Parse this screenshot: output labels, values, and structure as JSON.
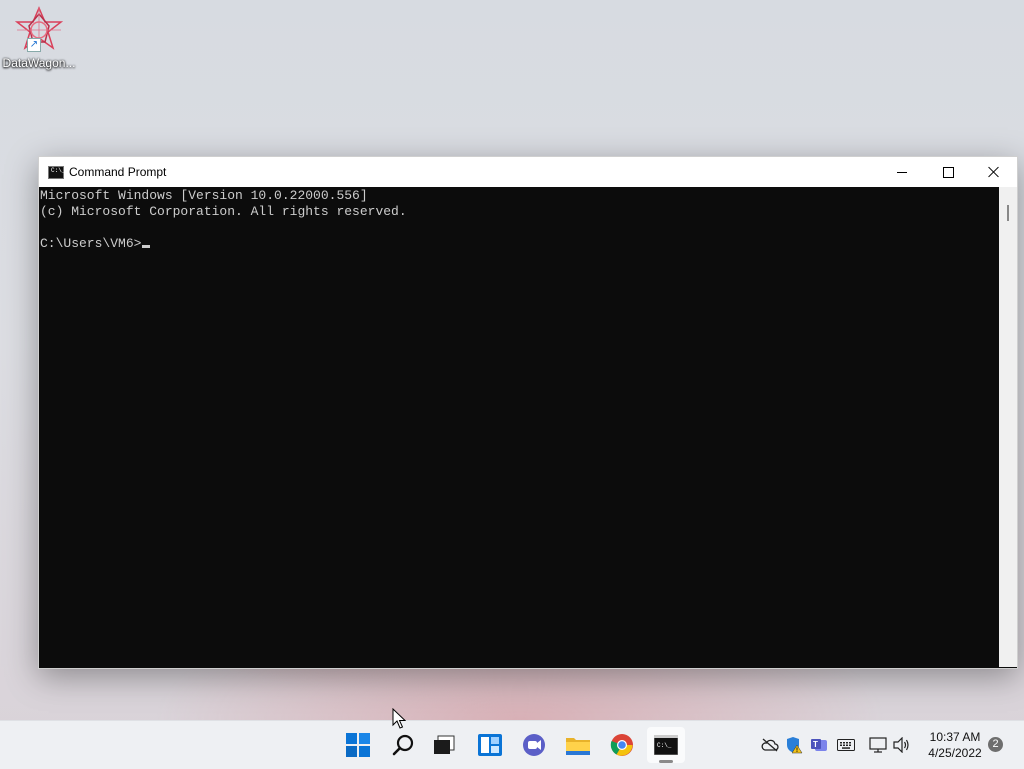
{
  "desktop": {
    "icons": [
      {
        "label": "DataWagon...",
        "icon": "datawagon-icon",
        "shortcut_icon": "shortcut-arrow-icon"
      }
    ]
  },
  "window": {
    "title": "Command Prompt",
    "icon": "terminal-app-icon",
    "icon_text": "C:\\_",
    "controls": [
      "minimize",
      "maximize",
      "close"
    ]
  },
  "console": {
    "lines": [
      "Microsoft Windows [Version 10.0.22000.556]",
      "(c) Microsoft Corporation. All rights reserved.",
      "",
      "C:\\Users\\VM6>"
    ]
  },
  "taskbar": {
    "pinned": [
      {
        "name": "start",
        "icon": "windows-start-icon"
      },
      {
        "name": "search",
        "icon": "search-icon"
      },
      {
        "name": "task-view",
        "icon": "task-view-icon"
      },
      {
        "name": "widgets",
        "icon": "widgets-icon"
      },
      {
        "name": "chat",
        "icon": "teams-chat-icon"
      },
      {
        "name": "file-explorer",
        "icon": "folder-icon"
      },
      {
        "name": "chrome",
        "icon": "chrome-icon"
      },
      {
        "name": "command-prompt",
        "icon": "terminal-icon",
        "active": true
      }
    ],
    "tray": [
      {
        "name": "onedrive",
        "icon": "cloud-off-icon"
      },
      {
        "name": "security",
        "icon": "shield-warning-icon"
      },
      {
        "name": "teams",
        "icon": "teams-icon"
      },
      {
        "name": "keyboard",
        "icon": "keyboard-icon"
      },
      {
        "name": "network",
        "icon": "network-icon"
      },
      {
        "name": "volume",
        "icon": "speaker-icon"
      }
    ],
    "time": "10:37 AM",
    "date": "4/25/2022",
    "notification_count": "2"
  },
  "colors": {
    "console_bg": "#0c0c0c",
    "console_fg": "#cccccc",
    "taskbar_bg": "#eef0f3",
    "windows_blue": "#0a74d6"
  }
}
